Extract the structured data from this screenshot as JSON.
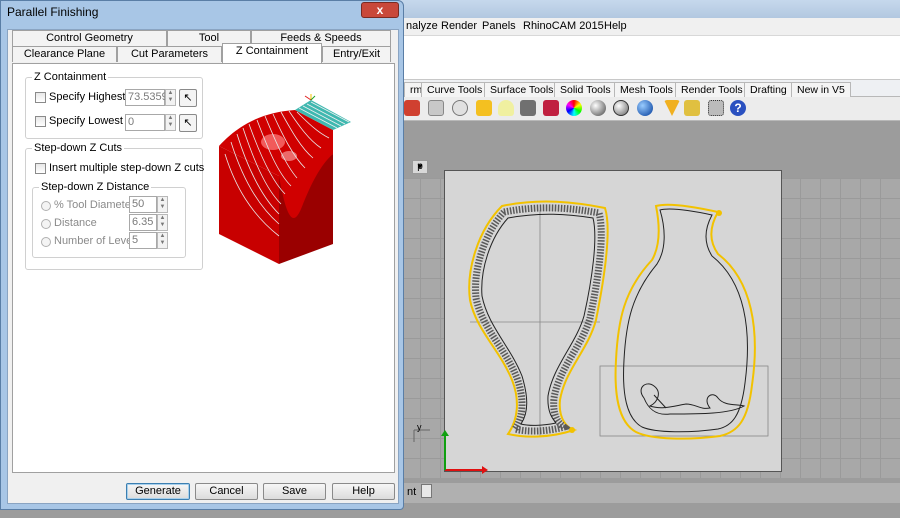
{
  "app": {
    "menu": [
      "nalyze",
      "Render",
      "Panels",
      "RhinoCAM 2015",
      "Help"
    ],
    "toolbar_tabs": [
      "rm",
      "Curve Tools",
      "Surface Tools",
      "Solid Tools",
      "Mesh Tools",
      "Render Tools",
      "Drafting",
      "New in V5"
    ],
    "viewport_label": "p",
    "axis_y_label": "y",
    "status_text": "nt"
  },
  "dialog": {
    "title": "Parallel Finishing",
    "close_label": "x",
    "tabs_row1": [
      "Control Geometry",
      "Tool",
      "Feeds & Speeds"
    ],
    "tabs_row2": [
      "Clearance Plane",
      "Cut Parameters",
      "Z Containment",
      "Entry/Exit"
    ],
    "active_tab": "Z Containment",
    "z_containment": {
      "group_title": "Z Containment",
      "highest_label": "Specify Highest Z",
      "highest_value": "73.5359",
      "lowest_label": "Specify Lowest Z",
      "lowest_value": "0"
    },
    "stepdown": {
      "group_title": "Step-down Z Cuts",
      "multi_label": "Insert multiple step-down Z cuts",
      "distance_group_title": "Step-down Z Distance",
      "tool_diam_label": "% Tool Diameter",
      "tool_diam_value": "50",
      "distance_label": "Distance",
      "distance_value": "6.35",
      "levels_label": "Number of Levels",
      "levels_value": "5"
    },
    "buttons": {
      "generate": "Generate",
      "cancel": "Cancel",
      "save": "Save",
      "help": "Help"
    }
  },
  "colors": {
    "dialog_frame": "#a8c6e6",
    "preview_red": "#d00000",
    "preview_cyan": "#3fb8b0",
    "toolpath_yellow": "#f2c200"
  }
}
